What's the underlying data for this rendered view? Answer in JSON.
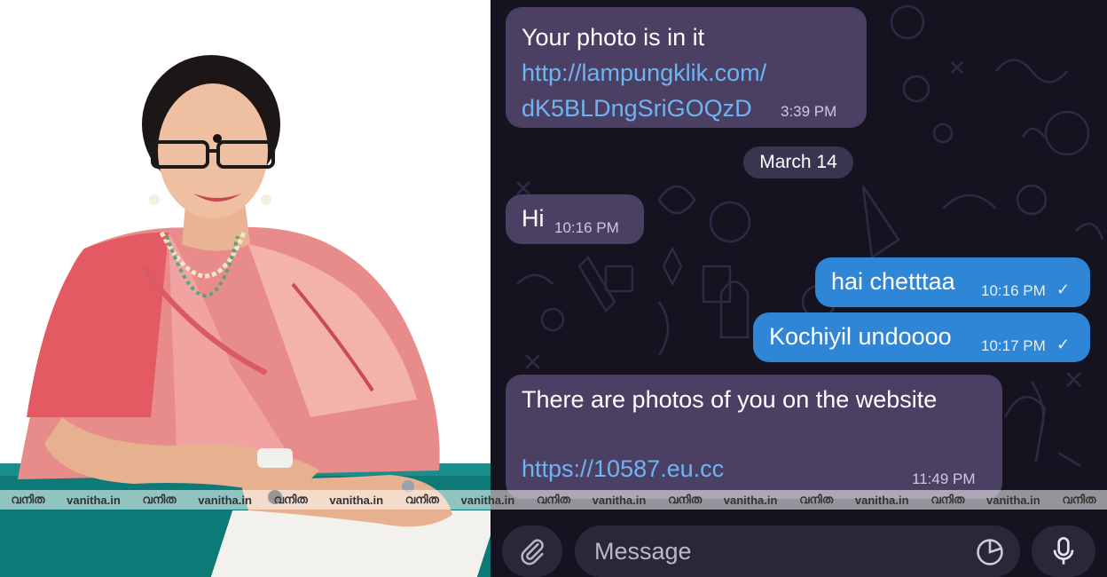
{
  "messages": [
    {
      "id": "m1",
      "direction": "incoming",
      "lines": [
        "Your photo is in it"
      ],
      "links": [
        "http://lampungklik.com/",
        "dK5BLDngSriGOQzD"
      ],
      "time": "3:39 PM"
    },
    {
      "id": "m2",
      "direction": "incoming",
      "text": "Hi",
      "time": "10:16 PM"
    },
    {
      "id": "m3",
      "direction": "outgoing",
      "text": "hai chetttaa",
      "time": "10:16 PM",
      "status": "✓"
    },
    {
      "id": "m4",
      "direction": "outgoing",
      "text": "Kochiyil undoooo",
      "time": "10:17 PM",
      "status": "✓"
    },
    {
      "id": "m5",
      "direction": "incoming",
      "text": "There are photos of you on the website",
      "link": "https://10587.eu.cc",
      "time": "11:49 PM"
    }
  ],
  "date_separator": "March 14",
  "composer": {
    "placeholder": "Message"
  },
  "icons": {
    "attach": "paperclip-icon",
    "sticker": "sticker-icon",
    "mic": "microphone-icon"
  },
  "watermark": {
    "logo": "വനിത",
    "site": "vanitha.in"
  },
  "colors": {
    "incoming_bubble": "#4b3f63",
    "outgoing_bubble": "#2f86d6",
    "link": "#6fb4f2",
    "chat_background": "#151320"
  }
}
